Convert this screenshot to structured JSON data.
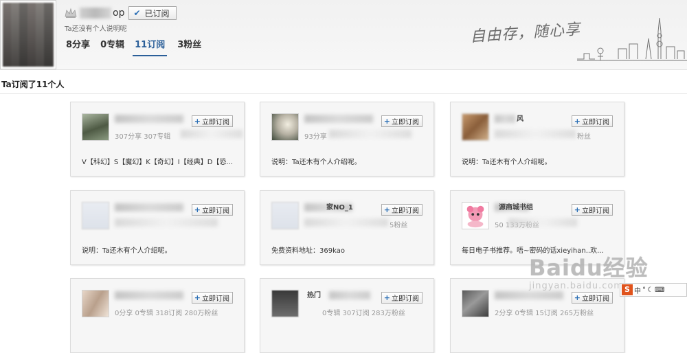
{
  "profile": {
    "username_suffix": "op",
    "subscribed_label": "已订阅",
    "bio": "Ta还没有个人说明呢",
    "tabs": [
      {
        "count": "8",
        "label": "分享"
      },
      {
        "count": "0",
        "label": "专辑"
      },
      {
        "count": "11",
        "label": "订阅"
      },
      {
        "count": "3",
        "label": "粉丝"
      }
    ],
    "slogan": "自由存，随心享"
  },
  "section_title": "Ta订阅了11个人",
  "subscribe_label": "立即订阅",
  "cards": [
    {
      "name": "",
      "stats": "307分享   307专辑",
      "desc": "V【科幻】S【魔幻】K【奇幻】I【经典】D【恐..."
    },
    {
      "name": "",
      "stats": "93分享",
      "desc": "说明：Ta还木有个人介绍呢。"
    },
    {
      "name": "风",
      "stats": "粉丝",
      "desc": "说明：Ta还木有个人介绍呢。"
    },
    {
      "name": "",
      "stats": "",
      "desc": "说明：Ta还木有个人介绍呢。"
    },
    {
      "name": "家NO_1",
      "stats": "5粉丝",
      "desc": "免费资料地址：369kao"
    },
    {
      "name": "源商城书组",
      "stats": "50          133万粉丝",
      "desc": "每日电子书推荐。唔~密码的话xieyihan..欢..."
    },
    {
      "name": "",
      "stats": "0分享   0专辑   318订阅   280万粉丝",
      "desc": ""
    },
    {
      "name": "热门",
      "stats": "0专辑   307订阅   283万粉丝",
      "desc": ""
    },
    {
      "name": "",
      "stats": "2分享   0专辑   15订阅   265万粉丝",
      "desc": ""
    }
  ],
  "watermark": {
    "logo": "Baidu经验",
    "url": "jingyan.baidu.com"
  },
  "tray": {
    "ime": "S",
    "items": [
      "中",
      "°",
      "☾",
      "⌨"
    ]
  }
}
